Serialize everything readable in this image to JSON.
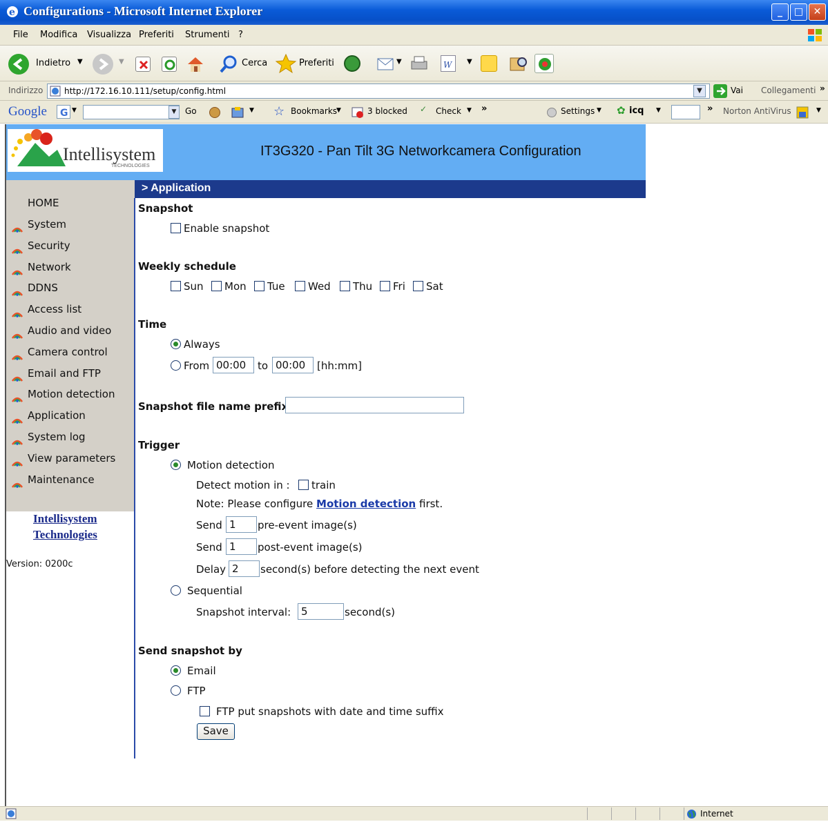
{
  "window": {
    "title": "Configurations - Microsoft Internet Explorer",
    "min_glyph": "_",
    "max_glyph": "□",
    "close_glyph": "✕"
  },
  "menu": [
    "File",
    "Modifica",
    "Visualizza",
    "Preferiti",
    "Strumenti",
    "?"
  ],
  "toolbar": {
    "back": "Indietro",
    "search": "Cerca",
    "favorites": "Preferiti"
  },
  "address": {
    "label": "Indirizzo",
    "url": "http://172.16.10.111/setup/config.html",
    "go": "Vai",
    "links": "Collegamenti"
  },
  "googlebar": {
    "logo": "Google",
    "go": "Go",
    "bookmarks": "Bookmarks",
    "blocked": "3 blocked",
    "check": "Check",
    "settings": "Settings",
    "icq": "icq",
    "norton": "Norton AntiVirus",
    "more": "»"
  },
  "header": {
    "logo_text": "Intellisystem",
    "logo_sub": "TECHNOLOGIES",
    "title": "IT3G320 - Pan Tilt 3G Networkcamera Configuration",
    "section": "> Application"
  },
  "sidebar": {
    "home": "HOME",
    "items": [
      "System",
      "Security",
      "Network",
      "DDNS",
      "Access list",
      "Audio and video",
      "Camera control",
      "Email and FTP",
      "Motion detection",
      "Application",
      "System log",
      "View parameters",
      "Maintenance"
    ],
    "company_line1": "Intellisystem",
    "company_line2": "Technologies",
    "version": "Version: 0200c"
  },
  "form": {
    "snapshot_heading": "Snapshot",
    "enable_snapshot": "Enable snapshot",
    "weekly_heading": "Weekly schedule",
    "days": [
      "Sun",
      "Mon",
      "Tue",
      "Wed",
      "Thu",
      "Fri",
      "Sat"
    ],
    "time_heading": "Time",
    "always": "Always",
    "from": "From",
    "from_value": "00:00",
    "to": "to",
    "to_value": "00:00",
    "hhmm": "[hh:mm]",
    "prefix_label": "Snapshot file name prefix",
    "prefix_value": "",
    "trigger_heading": "Trigger",
    "motion_detection": "Motion detection",
    "detect_in": "Detect motion in :",
    "train": "train",
    "note_pre": "Note: Please configure ",
    "note_link": "Motion detection",
    "note_post": " first.",
    "send": "Send",
    "pre_value": "1",
    "pre_label": "pre-event image(s)",
    "post_value": "1",
    "post_label": "post-event image(s)",
    "delay": "Delay",
    "delay_value": "2",
    "delay_label": "second(s) before detecting the next event",
    "sequential": "Sequential",
    "interval_label": "Snapshot interval:",
    "interval_value": "5",
    "interval_unit": "second(s)",
    "sendby_heading": "Send snapshot by",
    "email": "Email",
    "ftp": "FTP",
    "ftp_suffix": "FTP put snapshots with date and time suffix",
    "save": "Save"
  },
  "status": {
    "zone": "Internet"
  }
}
